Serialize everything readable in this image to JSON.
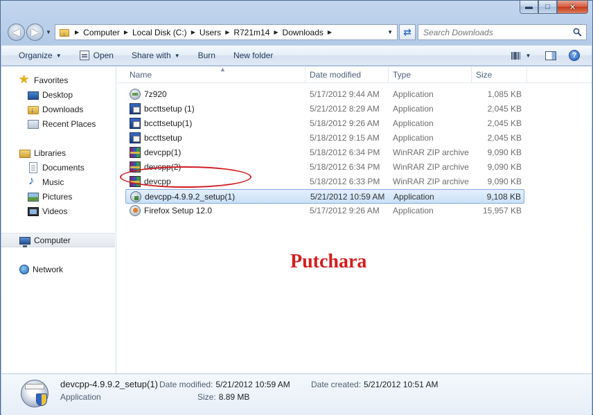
{
  "window": {
    "caption_buttons": {
      "minimize": "▬",
      "maximize": "□",
      "close": "✕"
    }
  },
  "nav": {
    "back_icon": "back-arrow-icon",
    "forward_icon": "forward-arrow-icon",
    "breadcrumbs": [
      "Computer",
      "Local Disk (C:)",
      "Users",
      "R721m14",
      "Downloads"
    ],
    "search_placeholder": "Search Downloads"
  },
  "toolbar": {
    "organize": "Organize",
    "open": "Open",
    "share_with": "Share with",
    "burn": "Burn",
    "new_folder": "New folder"
  },
  "sidebar": {
    "favorites": {
      "label": "Favorites",
      "items": [
        "Desktop",
        "Downloads",
        "Recent Places"
      ]
    },
    "libraries": {
      "label": "Libraries",
      "items": [
        "Documents",
        "Music",
        "Pictures",
        "Videos"
      ]
    },
    "computer": "Computer",
    "network": "Network"
  },
  "columns": {
    "name": "Name",
    "date": "Date modified",
    "type": "Type",
    "size": "Size"
  },
  "files": [
    {
      "name": "7z920",
      "date": "5/17/2012 9:44 AM",
      "type": "Application",
      "size": "1,085 KB",
      "icon": "app"
    },
    {
      "name": "bccttsetup (1)",
      "date": "5/21/2012 8:29 AM",
      "type": "Application",
      "size": "2,045 KB",
      "icon": "setup"
    },
    {
      "name": "bccttsetup(1)",
      "date": "5/18/2012 9:26 AM",
      "type": "Application",
      "size": "2,045 KB",
      "icon": "setup"
    },
    {
      "name": "bccttsetup",
      "date": "5/18/2012 9:15 AM",
      "type": "Application",
      "size": "2,045 KB",
      "icon": "setup"
    },
    {
      "name": "devcpp(1)",
      "date": "5/18/2012 6:34 PM",
      "type": "WinRAR ZIP archive",
      "size": "9,090 KB",
      "icon": "rar"
    },
    {
      "name": "devcpp(2)",
      "date": "5/18/2012 6:34 PM",
      "type": "WinRAR ZIP archive",
      "size": "9,090 KB",
      "icon": "rar"
    },
    {
      "name": "devcpp",
      "date": "5/18/2012 6:33 PM",
      "type": "WinRAR ZIP archive",
      "size": "9,090 KB",
      "icon": "rar"
    },
    {
      "name": "devcpp-4.9.9.2_setup(1)",
      "date": "5/21/2012 10:59 AM",
      "type": "Application",
      "size": "9,108 KB",
      "icon": "dev",
      "selected": true
    },
    {
      "name": "Firefox Setup 12.0",
      "date": "5/17/2012 9:26 AM",
      "type": "Application",
      "size": "15,957 KB",
      "icon": "ff"
    }
  ],
  "watermark": "Putchara",
  "details": {
    "name": "devcpp-4.9.9.2_setup(1)",
    "type": "Application",
    "date_modified_label": "Date modified:",
    "date_modified": "5/21/2012 10:59 AM",
    "date_created_label": "Date created:",
    "date_created": "5/21/2012 10:51 AM",
    "size_label": "Size:",
    "size": "8.89 MB"
  },
  "colors": {
    "accent": "#2a6bc4",
    "selection": "#c9e0f7",
    "annotation": "#d21a22"
  }
}
